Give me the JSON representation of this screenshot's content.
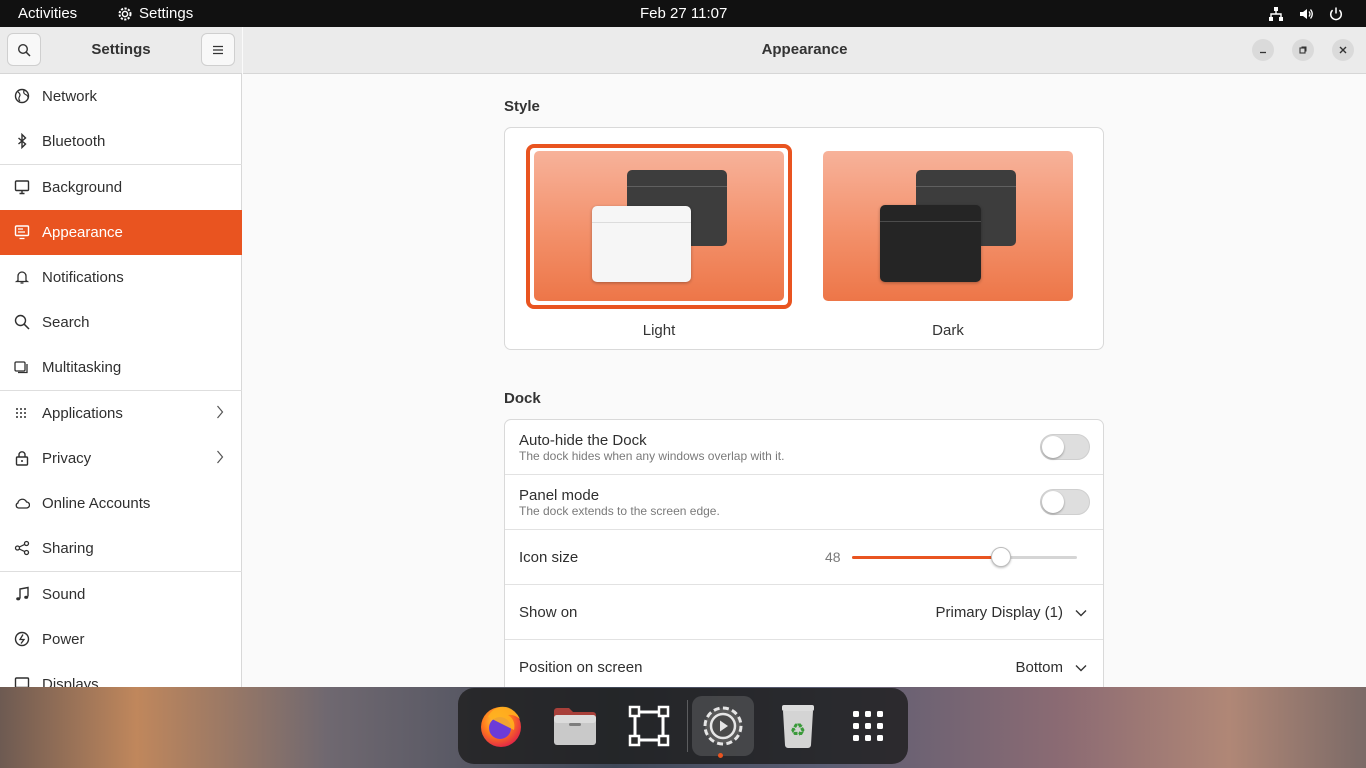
{
  "topbar": {
    "activities": "Activities",
    "app_name": "Settings",
    "clock": "Feb 27  11:07",
    "icons": [
      "network-wired-icon",
      "volume-icon",
      "power-icon"
    ]
  },
  "sidebar": {
    "title": "Settings",
    "items": [
      {
        "label": "Network",
        "icon": "globe-icon"
      },
      {
        "label": "Bluetooth",
        "icon": "bluetooth-icon"
      },
      {
        "label": "Background",
        "icon": "monitor-icon"
      },
      {
        "label": "Appearance",
        "icon": "appearance-icon",
        "active": true
      },
      {
        "label": "Notifications",
        "icon": "bell-icon"
      },
      {
        "label": "Search",
        "icon": "search-icon"
      },
      {
        "label": "Multitasking",
        "icon": "multitasking-icon"
      },
      {
        "label": "Applications",
        "icon": "apps-grid-icon",
        "chevron": true
      },
      {
        "label": "Privacy",
        "icon": "lock-icon",
        "chevron": true
      },
      {
        "label": "Online Accounts",
        "icon": "cloud-icon"
      },
      {
        "label": "Sharing",
        "icon": "share-icon"
      },
      {
        "label": "Sound",
        "icon": "music-note-icon"
      },
      {
        "label": "Power",
        "icon": "power-icon"
      },
      {
        "label": "Displays",
        "icon": "display-icon"
      }
    ]
  },
  "window": {
    "title": "Appearance"
  },
  "style": {
    "section_title": "Style",
    "options": [
      {
        "label": "Light",
        "selected": true
      },
      {
        "label": "Dark",
        "selected": false
      }
    ]
  },
  "dock": {
    "section_title": "Dock",
    "autohide": {
      "title": "Auto-hide the Dock",
      "subtitle": "The dock hides when any windows overlap with it.",
      "enabled": false
    },
    "panel_mode": {
      "title": "Panel mode",
      "subtitle": "The dock extends to the screen edge.",
      "enabled": false
    },
    "icon_size": {
      "title": "Icon size",
      "value": "48",
      "fraction": 0.66
    },
    "show_on": {
      "title": "Show on",
      "value": "Primary Display (1)"
    },
    "position": {
      "title": "Position on screen",
      "value": "Bottom"
    }
  },
  "taskbar": {
    "apps": [
      "firefox-icon",
      "files-icon",
      "screenshot-icon",
      "settings-icon",
      "trash-icon",
      "show-apps-icon"
    ]
  },
  "colors": {
    "accent": "#e95420",
    "topbar": "#111111"
  }
}
